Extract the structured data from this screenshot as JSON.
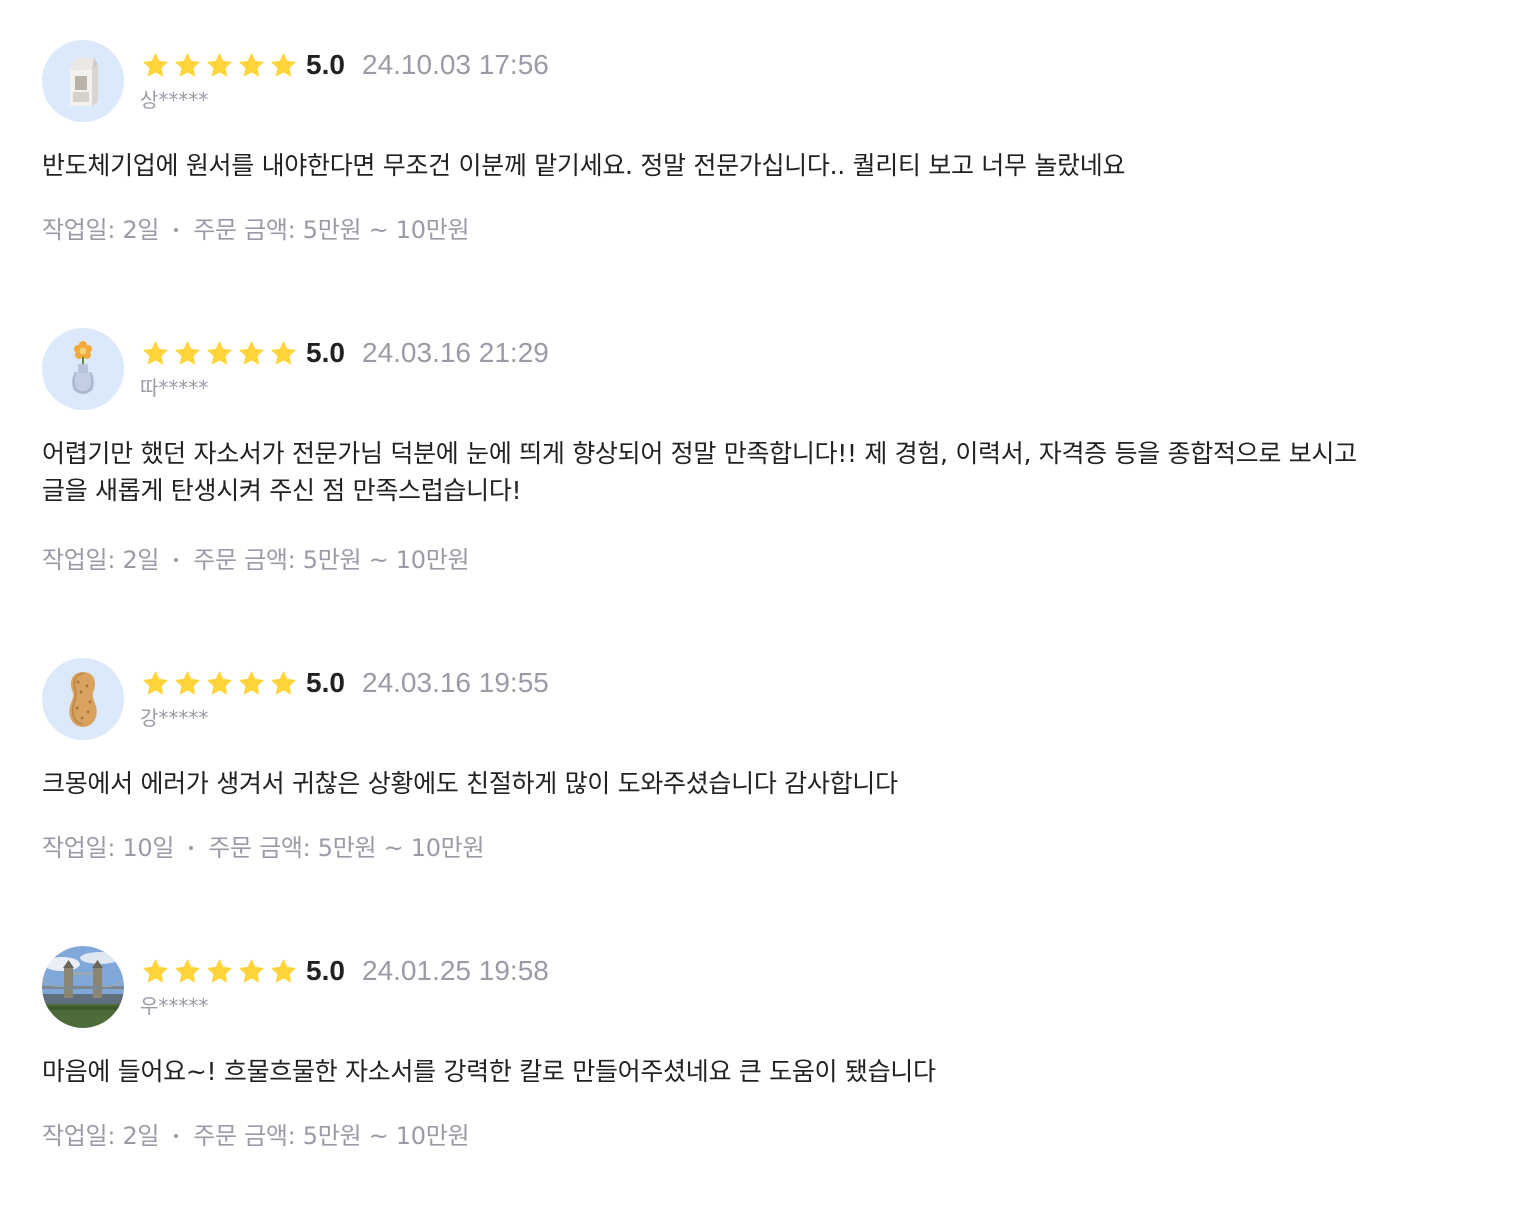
{
  "colors": {
    "star": "#ffd43b",
    "text_primary": "#212224",
    "text_secondary": "#9a9ba7",
    "avatar_bg": "#dbe9fb"
  },
  "reviews": [
    {
      "avatar_icon": "milk-carton-icon",
      "rating": 5,
      "score": "5.0",
      "date": "24.10.03 17:56",
      "nickname": "상*****",
      "body": "반도체기업에 원서를 내야한다면 무조건 이분께 맡기세요. 정말 전문가십니다.. 퀄리티 보고 너무 놀랐네요",
      "work_days": "작업일: 2일",
      "order_amount": "주문 금액: 5만원 ~ 10만원"
    },
    {
      "avatar_icon": "flower-vase-icon",
      "rating": 5,
      "score": "5.0",
      "date": "24.03.16 21:29",
      "nickname": "따*****",
      "body": "어렵기만 했던 자소서가 전문가님 덕분에 눈에 띄게 향상되어 정말 만족합니다!! 제 경험, 이력서, 자격증 등을 종합적으로 보시고\n글을 새롭게 탄생시켜 주신 점 만족스럽습니다!",
      "work_days": "작업일: 2일",
      "order_amount": "주문 금액: 5만원 ~ 10만원"
    },
    {
      "avatar_icon": "peanut-icon",
      "rating": 5,
      "score": "5.0",
      "date": "24.03.16 19:55",
      "nickname": "강*****",
      "body": "크몽에서 에러가 생겨서 귀찮은 상황에도 친절하게 많이 도와주셨습니다 감사합니다",
      "work_days": "작업일: 10일",
      "order_amount": "주문 금액: 5만원 ~ 10만원"
    },
    {
      "avatar_icon": "tower-bridge-photo-icon",
      "rating": 5,
      "score": "5.0",
      "date": "24.01.25 19:58",
      "nickname": "우*****",
      "body": "마음에 들어요~! 흐물흐물한 자소서를 강력한 칼로 만들어주셨네요 큰 도움이 됐습니다",
      "work_days": "작업일: 2일",
      "order_amount": "주문 금액: 5만원 ~ 10만원"
    }
  ]
}
